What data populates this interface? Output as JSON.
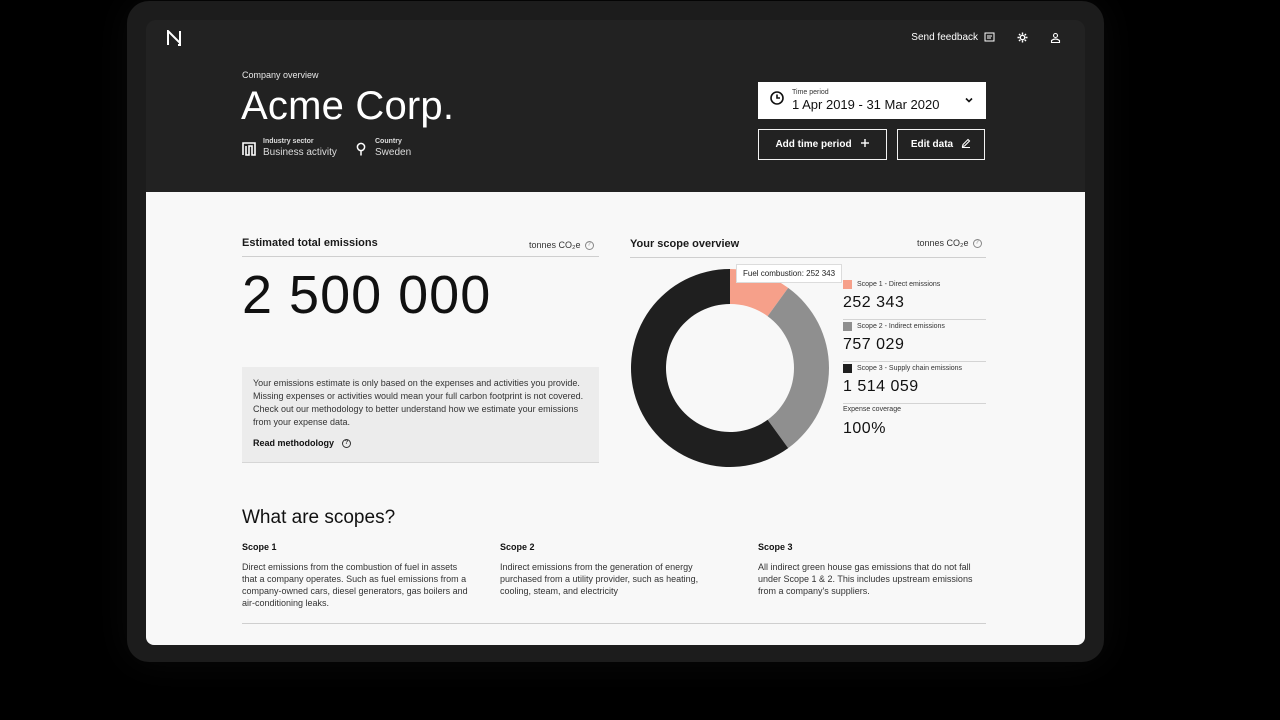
{
  "app": {
    "logo_letter": "N"
  },
  "top_nav": {
    "feedback_label": "Send feedback",
    "icons": [
      "feedback-icon",
      "gear-icon",
      "user-icon"
    ]
  },
  "company": {
    "overview_label": "Company overview",
    "name": "Acme Corp.",
    "sector_label": "Industry sector",
    "sector_value": "Business activity",
    "country_label": "Country",
    "country_value": "Sweden"
  },
  "time_period": {
    "label": "Time period",
    "value": "1 Apr 2019 - 31 Mar 2020"
  },
  "actions": {
    "add_time_period": "Add time period",
    "edit_data": "Edit data"
  },
  "total": {
    "title": "Estimated total emissions",
    "units": "tonnes CO₂e",
    "value": "2 500 000",
    "info_text": "Your emissions estimate is only based on the expenses and activities you provide. Missing expenses or activities would mean your full carbon footprint is not covered. Check out our methodology to better understand how we estimate your emissions from your expense data.",
    "read_methodology": "Read methodology"
  },
  "scope_overview": {
    "title": "Your scope overview",
    "units": "tonnes CO₂e",
    "tooltip": "Fuel combustion: 252 343",
    "items": [
      {
        "label": "Scope 1 - Direct emissions",
        "value": "252 343",
        "color": "#f6a08a",
        "amount": 252343
      },
      {
        "label": "Scope 2 - Indirect emissions",
        "value": "757 029",
        "color": "#8f8f8f",
        "amount": 757029
      },
      {
        "label": "Scope 3 - Supply chain emissions",
        "value": "1 514 059",
        "color": "#1f1f1f",
        "amount": 1514059
      }
    ],
    "coverage_label": "Expense coverage",
    "coverage_value": "100%"
  },
  "scopes_info": {
    "title": "What are scopes?",
    "columns": [
      {
        "title": "Scope 1",
        "text": "Direct emissions from the combustion of fuel in assets that a company operates. Such as fuel emissions from a company-owned cars, diesel generators, gas boilers and air-conditioning leaks."
      },
      {
        "title": "Scope 2",
        "text": "Indirect emissions from the generation of energy purchased from a utility provider, such as heating, cooling, steam, and electricity"
      },
      {
        "title": "Scope 3",
        "text": "All indirect green house gas emissions that do not fall under Scope 1 & 2. This includes upstream emissions from a company's suppliers."
      }
    ]
  }
}
